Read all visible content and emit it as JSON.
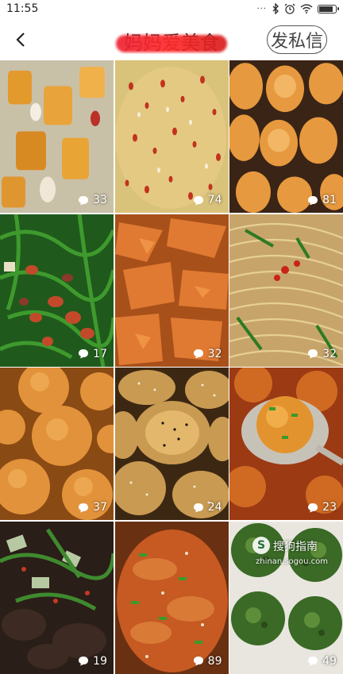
{
  "status_bar": {
    "time": "11:55"
  },
  "header": {
    "title": "妈妈爱美食",
    "dm_label": "发私信"
  },
  "posts": [
    {
      "comments": "33"
    },
    {
      "comments": "74"
    },
    {
      "comments": "81"
    },
    {
      "comments": "17"
    },
    {
      "comments": "32"
    },
    {
      "comments": "32"
    },
    {
      "comments": "37"
    },
    {
      "comments": "24"
    },
    {
      "comments": "23"
    },
    {
      "comments": "19"
    },
    {
      "comments": "89"
    },
    {
      "comments": "49"
    }
  ],
  "watermark": {
    "logo": "S",
    "title": "搜狗指南",
    "url": "zhinan.sogou.com"
  },
  "colors": {
    "redaction": "#e8222a",
    "comment_text": "#ffffff"
  }
}
